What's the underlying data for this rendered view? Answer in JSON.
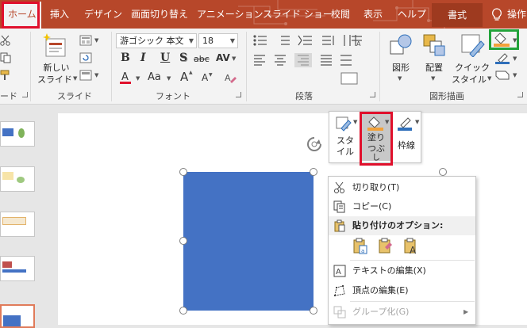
{
  "ribbon_tabs": [
    "ホーム",
    "挿入",
    "デザイン",
    "画面切り替え",
    "アニメーション",
    "スライド ショー",
    "校閲",
    "表示",
    "ヘルプ"
  ],
  "contextual_tab": "書式",
  "tell_me": "操作",
  "groups": {
    "clipboard": "ード",
    "slide": "スライド",
    "font": "フォント",
    "paragraph": "段落",
    "drawing": "図形描画"
  },
  "slide_buttons": {
    "new_slide_line1": "新しい",
    "new_slide_line2": "スライド"
  },
  "font": {
    "name": "游ゴシック 本文",
    "size": "18"
  },
  "format_buttons": {
    "bold": "B",
    "italic": "I",
    "underline": "U",
    "shadow": "S",
    "strike": "abc",
    "spacing": "AV",
    "case": "Aa",
    "grow": "A",
    "shrink": "A"
  },
  "drawing_buttons": {
    "shapes": "図形",
    "arrange": "配置",
    "quick_style_line1": "クイック",
    "quick_style_line2": "スタイル"
  },
  "mini_toolbar": {
    "style_line1": "スタ",
    "style_line2": "イル",
    "fill_line1": "塗り",
    "fill_line2": "つぶ",
    "fill_line3": "し",
    "outline": "枠線"
  },
  "context_menu": {
    "cut": "切り取り(T)",
    "copy": "コピー(C)",
    "paste_options": "貼り付けのオプション:",
    "edit_text": "テキストの編集(X)",
    "edit_points": "頂点の編集(E)",
    "group": "グループ化(G)"
  },
  "colors": {
    "ribbon_red": "#b7472a",
    "shape_fill": "#4472c4",
    "highlight_red": "#e0102c",
    "highlight_green": "#21a33a"
  }
}
